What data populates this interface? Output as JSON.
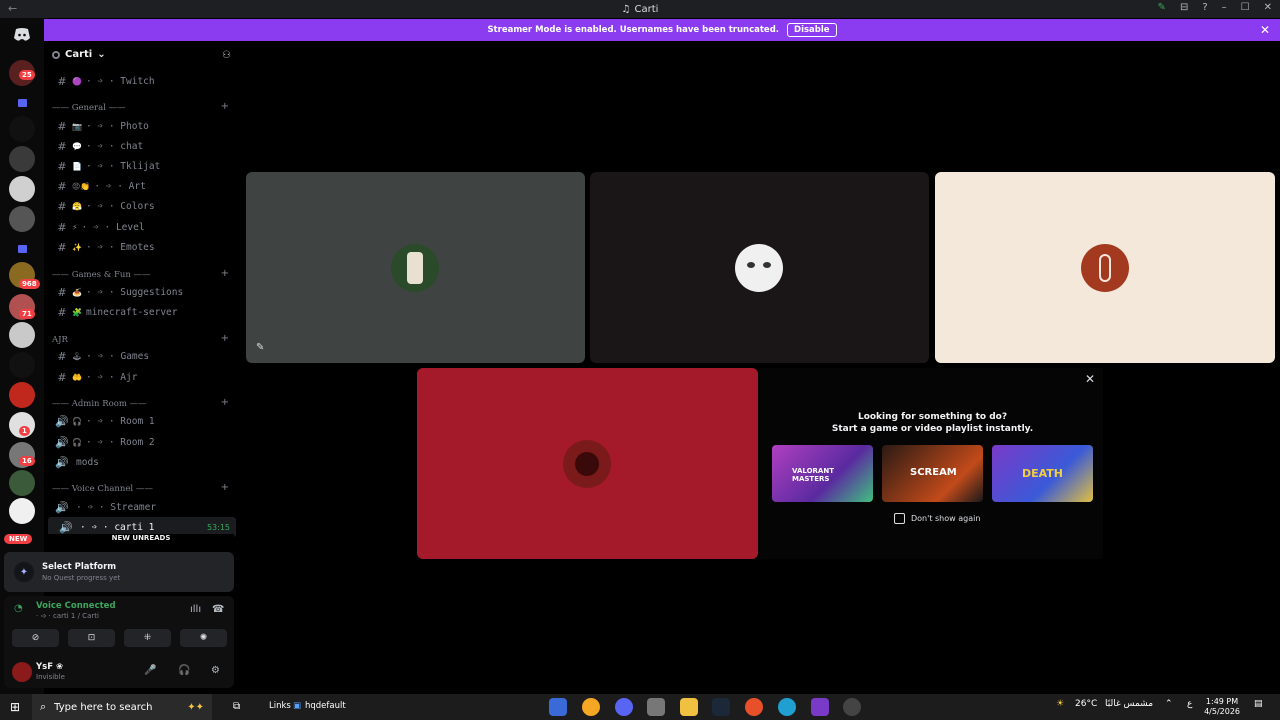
{
  "window": {
    "title": "Carti",
    "back_glyph": "←",
    "controls": [
      "–",
      "☐",
      "✕"
    ],
    "nitro_glyph": "✎",
    "inbox_glyph": "⊟",
    "help_glyph": "?"
  },
  "banner": {
    "text": "Streamer Mode is enabled. Usernames have been truncated.",
    "button": "Disable",
    "close_glyph": "✕",
    "color": "#8c3cf0"
  },
  "server": {
    "name": "Carti",
    "chevron": "⌄",
    "add_member_glyph": "⚇"
  },
  "server_rail": {
    "home_icon": "discord-logo",
    "badges": [
      "25",
      "968",
      "71",
      "1",
      "16"
    ],
    "new_label": "NEW"
  },
  "channels": {
    "top": [
      {
        "glyph": "#",
        "emoji": "🟣",
        "label": "· ➩ · Twitch"
      }
    ],
    "general": {
      "title": "—— General ——",
      "items": [
        {
          "glyph": "#",
          "emoji": "📷",
          "label": "· ➩ · Photo"
        },
        {
          "glyph": "#",
          "emoji": "💬",
          "label": "· ➩ · chat"
        },
        {
          "glyph": "#",
          "emoji": "📄",
          "label": "· ➩ · Tklijat"
        },
        {
          "glyph": "#",
          "emoji": "😡👏",
          "label": "· ➩ · Art"
        },
        {
          "glyph": "#",
          "emoji": "😤",
          "label": "· ➩ · Colors"
        },
        {
          "glyph": "#",
          "emoji": "⚡",
          "label": "· ➩ · Level"
        },
        {
          "glyph": "#",
          "emoji": "✨",
          "label": "· ➩ · Emotes"
        }
      ]
    },
    "games": {
      "title": "—— Games & Fun ——",
      "items": [
        {
          "glyph": "#",
          "emoji": "🍝",
          "label": "· ➩ · Suggestions"
        },
        {
          "glyph": "#",
          "emoji": "🧩",
          "label": "minecraft-server"
        }
      ]
    },
    "ajr": {
      "title": "AJR",
      "items": [
        {
          "glyph": "#",
          "emoji": "🕹",
          "label": "· ➩ · Games"
        },
        {
          "glyph": "#",
          "emoji": "🤲",
          "label": "· ➩ · Ajr"
        }
      ]
    },
    "admin": {
      "title": "—— Admin Room ——",
      "items": [
        {
          "glyph": "🔊",
          "emoji": "🎧",
          "label": "· ➩ · Room 1"
        },
        {
          "glyph": "🔊",
          "emoji": "🎧",
          "label": "· ➩ · Room 2"
        },
        {
          "glyph": "🔊",
          "emoji": "",
          "label": "mods"
        }
      ]
    },
    "voice": {
      "title": "—— Voice Channel ——",
      "items": [
        {
          "glyph": "🔊",
          "emoji": "",
          "label": "· ➩ · Streamer"
        },
        {
          "glyph": "🔊",
          "emoji": "",
          "label": "· ➩ · carti 1",
          "time": "53:15"
        }
      ]
    },
    "plus": "+",
    "new_unreads": "NEW UNREADS"
  },
  "quest": {
    "title": "Select Platform",
    "subtitle": "No Quest progress yet"
  },
  "voice_panel": {
    "status": "Voice Connected",
    "channel": "· ➩ · carti 1 / Carti",
    "buttons": [
      "⊘",
      "⊡",
      "⁜",
      "✺"
    ]
  },
  "user": {
    "name": "YsF ❀",
    "status": "Invisible",
    "mic": "🎤",
    "headset": "🎧",
    "settings": "⚙"
  },
  "tiles": [
    {
      "bg": "#3f4341",
      "avatar_bg": "#2a4a2a",
      "muted": true
    },
    {
      "bg": "#1a1516",
      "avatar_bg": "#f0f0f0",
      "muted": false
    },
    {
      "bg": "#f3e8da",
      "avatar_bg": "#a33a1f",
      "muted": false
    },
    {
      "bg": "#a51a2b",
      "avatar_bg": "#7a1a1a",
      "muted": false
    }
  ],
  "activity": {
    "heading": "Looking for something to do?",
    "subheading": "Start a game or video playlist instantly.",
    "games": [
      {
        "title": "VALORANT MASTERS",
        "color": "#7a34b5"
      },
      {
        "title": "SCREAM",
        "color": "#1a1a1a"
      },
      {
        "title": "DEATH",
        "color": "#6a2fb8"
      }
    ],
    "dont_show": "Don't show again",
    "close": "✕"
  },
  "taskbar": {
    "search_placeholder": "Type here to search",
    "links": "Links",
    "hqdefault": "hqdefault",
    "weather": "26°C",
    "location": "مشمس غالبًا",
    "lang": "ع",
    "time": "1:49 PM",
    "date": "4/5/2026"
  }
}
